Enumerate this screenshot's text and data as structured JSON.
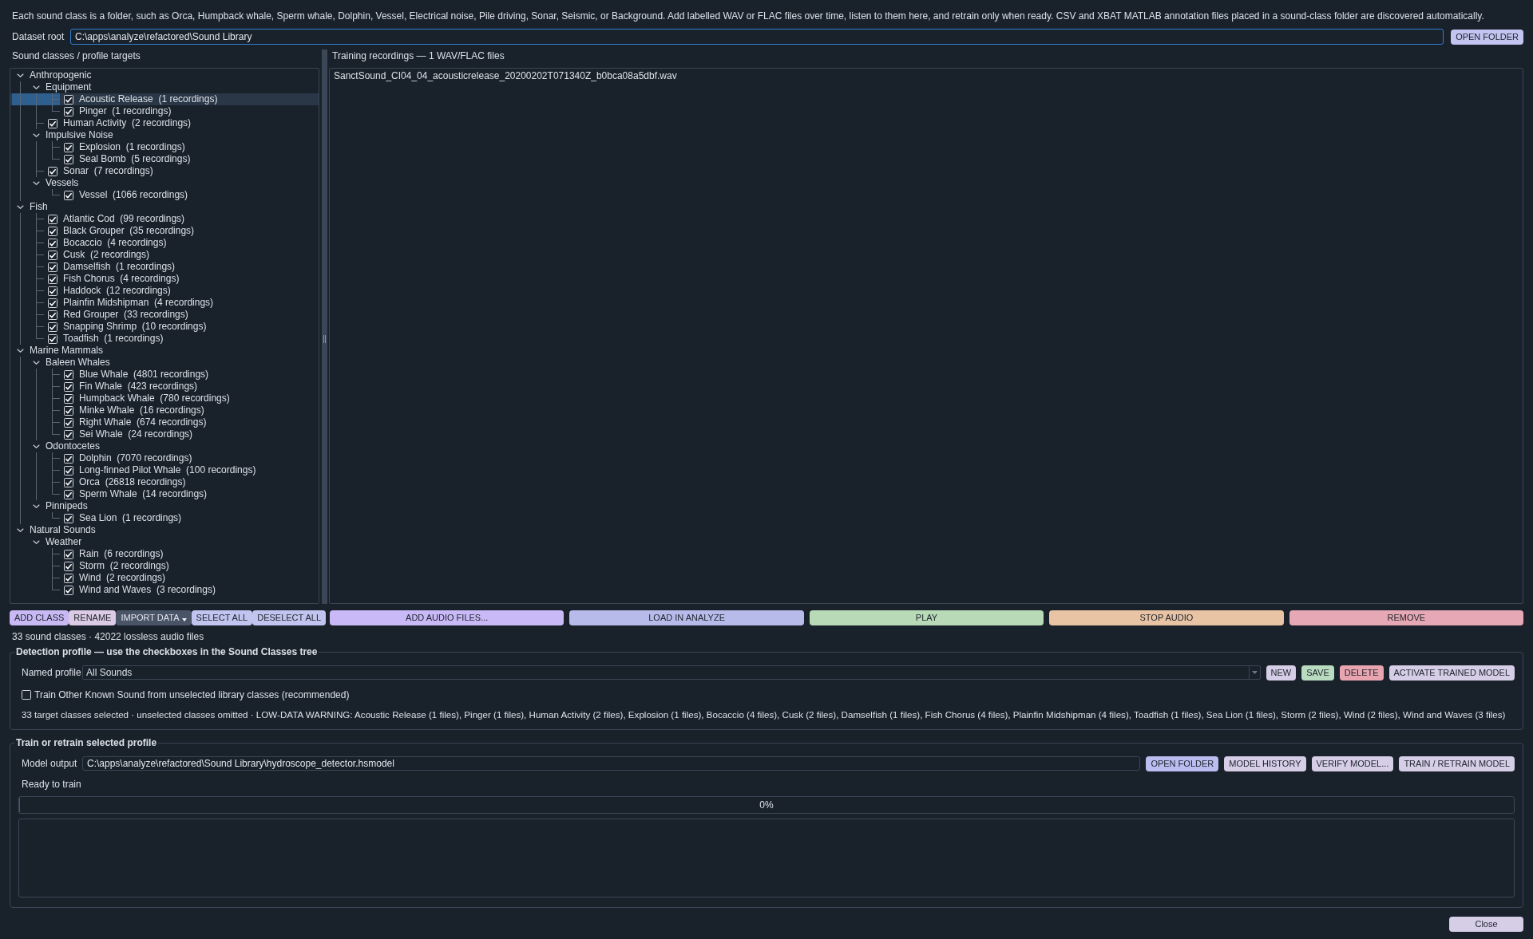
{
  "intro": "Each sound class is a folder, such as Orca, Humpback whale, Sperm whale, Dolphin, Vessel, Electrical noise, Pile driving, Sonar, Seismic, or Background. Add labelled WAV or FLAC files over time, listen to them here, and retrain only when ready. CSV and XBAT MATLAB annotation files placed in a sound-class folder are discovered automatically.",
  "dataset_root": {
    "label": "Dataset root",
    "value": "C:\\apps\\analyze\\refactored\\Sound Library",
    "focused": true,
    "button": "OPEN FOLDER"
  },
  "sound_classes": {
    "title": "Sound classes / profile targets",
    "tree": [
      {
        "label": "Anthropogenic",
        "expanded": true,
        "selected": false,
        "children": [
          {
            "label": "Equipment",
            "expanded": true,
            "selected": false,
            "children": [
              {
                "label": "Acoustic Release  (1 recordings)",
                "checked": true,
                "selected": true
              },
              {
                "label": "Pinger  (1 recordings)",
                "checked": true,
                "selected": false
              }
            ]
          },
          {
            "label": "Human Activity  (2 recordings)",
            "checked": true,
            "selected": false
          },
          {
            "label": "Impulsive Noise",
            "expanded": true,
            "selected": false,
            "children": [
              {
                "label": "Explosion  (1 recordings)",
                "checked": true,
                "selected": false
              },
              {
                "label": "Seal Bomb  (5 recordings)",
                "checked": true,
                "selected": false
              }
            ]
          },
          {
            "label": "Sonar  (7 recordings)",
            "checked": true,
            "selected": false
          },
          {
            "label": "Vessels",
            "expanded": true,
            "selected": false,
            "children": [
              {
                "label": "Vessel  (1066 recordings)",
                "checked": true,
                "selected": false
              }
            ]
          }
        ]
      },
      {
        "label": "Fish",
        "expanded": true,
        "selected": false,
        "children": [
          {
            "label": "Atlantic Cod  (99 recordings)",
            "checked": true,
            "selected": false
          },
          {
            "label": "Black Grouper  (35 recordings)",
            "checked": true,
            "selected": false
          },
          {
            "label": "Bocaccio  (4 recordings)",
            "checked": true,
            "selected": false
          },
          {
            "label": "Cusk  (2 recordings)",
            "checked": true,
            "selected": false
          },
          {
            "label": "Damselfish  (1 recordings)",
            "checked": true,
            "selected": false
          },
          {
            "label": "Fish Chorus  (4 recordings)",
            "checked": true,
            "selected": false
          },
          {
            "label": "Haddock  (12 recordings)",
            "checked": true,
            "selected": false
          },
          {
            "label": "Plainfin Midshipman  (4 recordings)",
            "checked": true,
            "selected": false
          },
          {
            "label": "Red Grouper  (33 recordings)",
            "checked": true,
            "selected": false
          },
          {
            "label": "Snapping Shrimp  (10 recordings)",
            "checked": true,
            "selected": false
          },
          {
            "label": "Toadfish  (1 recordings)",
            "checked": true,
            "selected": false
          }
        ]
      },
      {
        "label": "Marine Mammals",
        "expanded": true,
        "selected": false,
        "children": [
          {
            "label": "Baleen Whales",
            "expanded": true,
            "selected": false,
            "children": [
              {
                "label": "Blue Whale  (4801 recordings)",
                "checked": true,
                "selected": false
              },
              {
                "label": "Fin Whale  (423 recordings)",
                "checked": true,
                "selected": false
              },
              {
                "label": "Humpback Whale  (780 recordings)",
                "checked": true,
                "selected": false
              },
              {
                "label": "Minke Whale  (16 recordings)",
                "checked": true,
                "selected": false
              },
              {
                "label": "Right Whale  (674 recordings)",
                "checked": true,
                "selected": false
              },
              {
                "label": "Sei Whale  (24 recordings)",
                "checked": true,
                "selected": false
              }
            ]
          },
          {
            "label": "Odontocetes",
            "expanded": true,
            "selected": false,
            "children": [
              {
                "label": "Dolphin  (7070 recordings)",
                "checked": true,
                "selected": false
              },
              {
                "label": "Long-finned Pilot Whale  (100 recordings)",
                "checked": true,
                "selected": false
              },
              {
                "label": "Orca  (26818 recordings)",
                "checked": true,
                "selected": false
              },
              {
                "label": "Sperm Whale  (14 recordings)",
                "checked": true,
                "selected": false
              }
            ]
          },
          {
            "label": "Pinnipeds",
            "expanded": true,
            "selected": false,
            "children": [
              {
                "label": "Sea Lion  (1 recordings)",
                "checked": true,
                "selected": false
              }
            ]
          }
        ]
      },
      {
        "label": "Natural Sounds",
        "expanded": true,
        "selected": false,
        "children": [
          {
            "label": "Weather",
            "expanded": true,
            "selected": false,
            "children": [
              {
                "label": "Rain  (6 recordings)",
                "checked": true,
                "selected": false
              },
              {
                "label": "Storm  (2 recordings)",
                "checked": true,
                "selected": false
              },
              {
                "label": "Wind  (2 recordings)",
                "checked": true,
                "selected": false
              },
              {
                "label": "Wind and Waves  (3 recordings)",
                "checked": true,
                "selected": false
              }
            ]
          }
        ]
      }
    ]
  },
  "training_recordings": {
    "title": "Training recordings — 1 WAV/FLAC files",
    "files": [
      {
        "name": "SanctSound_CI04_04_acousticrelease_20200202T071340Z_b0bca08a5dbf.wav",
        "selected": false
      }
    ]
  },
  "library_buttons": [
    {
      "label": "ADD CLASS",
      "kind": "button",
      "color": "#c8b9f4"
    },
    {
      "label": "RENAME",
      "kind": "button",
      "color": "#dccbe4"
    },
    {
      "label": "IMPORT DATA",
      "kind": "menu",
      "color": "#4a5467"
    },
    {
      "label": "SELECT ALL",
      "kind": "button",
      "color": "#c1c4ee"
    },
    {
      "label": "DESELECT ALL",
      "kind": "button",
      "color": "#c1c4ee"
    }
  ],
  "file_buttons": [
    {
      "label": "ADD AUDIO FILES...",
      "color": "#c9b9f6"
    },
    {
      "label": "LOAD IN ANALYZE",
      "color": "#b7bbe9"
    },
    {
      "label": "PLAY",
      "color": "#b9dab6"
    },
    {
      "label": "STOP AUDIO",
      "color": "#e8c4a4"
    },
    {
      "label": "REMOVE",
      "color": "#e5a8b4"
    }
  ],
  "status": "33 sound classes · 42022 lossless audio files",
  "detection_profile": {
    "title": "Detection profile — use the checkboxes in the Sound Classes tree",
    "named_profile": {
      "label": "Named profile",
      "value": "All Sounds"
    },
    "buttons": [
      {
        "label": "NEW",
        "color": "#d6cde6"
      },
      {
        "label": "SAVE",
        "color": "#b9dcc0"
      },
      {
        "label": "DELETE",
        "color": "#e8a5b0"
      },
      {
        "label": "ACTIVATE TRAINED MODEL",
        "color": "#d6cde6"
      }
    ],
    "train_other": {
      "label": "Train Other Known Sound from unselected library classes (recommended)",
      "checked": false
    },
    "summary": "33 target classes selected · unselected classes omitted · LOW-DATA WARNING: Acoustic Release (1 files), Pinger (1 files), Human Activity (2 files), Explosion (1 files), Bocaccio (4 files), Cusk (2 files), Damselfish (1 files), Fish Chorus (4 files), Plainfin Midshipman (4 files), Toadfish (1 files), Sea Lion (1 files), Storm (2 files), Wind (2 files), Wind and Waves (3 files)"
  },
  "train": {
    "title": "Train or retrain selected profile",
    "model_output": {
      "label": "Model output",
      "value": "C:\\apps\\analyze\\refactored\\Sound Library\\hydroscope_detector.hsmodel"
    },
    "buttons": [
      {
        "label": "OPEN FOLDER",
        "color": "#babdf0"
      },
      {
        "label": "MODEL HISTORY",
        "color": "#d6cde6"
      },
      {
        "label": "VERIFY MODEL...",
        "color": "#d6cde6"
      },
      {
        "label": "TRAIN / RETRAIN MODEL",
        "color": "#d6cde6"
      }
    ],
    "status": "Ready to train",
    "progress": {
      "level": 0,
      "text": "0%"
    }
  },
  "close_button": "Close"
}
